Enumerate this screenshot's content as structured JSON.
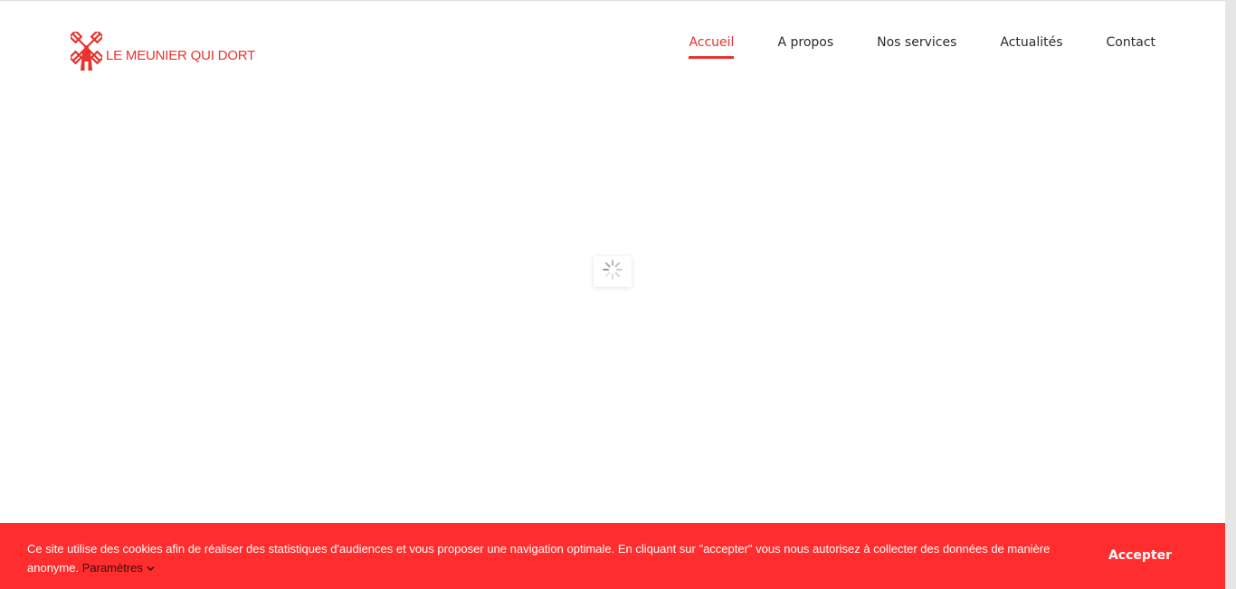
{
  "logo": {
    "text": "LE MEUNIER QUI DORT",
    "icon": "windmill-icon"
  },
  "nav": {
    "items": [
      {
        "label": "Accueil",
        "active": true
      },
      {
        "label": "A propos",
        "active": false
      },
      {
        "label": "Nos services",
        "active": false
      },
      {
        "label": "Actualités",
        "active": false
      },
      {
        "label": "Contact",
        "active": false
      }
    ]
  },
  "loader": {
    "icon": "loading-spinner-icon"
  },
  "cookie_banner": {
    "message": "Ce site utilise des cookies afin de réaliser des statistiques d'audiences et vous proposer une navigation optimale. En cliquant sur \"accepter\" vous nous autorisez à collecter des données de manière anonyme.",
    "settings_label": "Paramètres",
    "settings_icon": "chevron-down-icon",
    "accept_label": "Accepter"
  },
  "colors": {
    "brand": "#e8332e",
    "banner": "#ff2d2d",
    "text": "#2b2b2b"
  }
}
